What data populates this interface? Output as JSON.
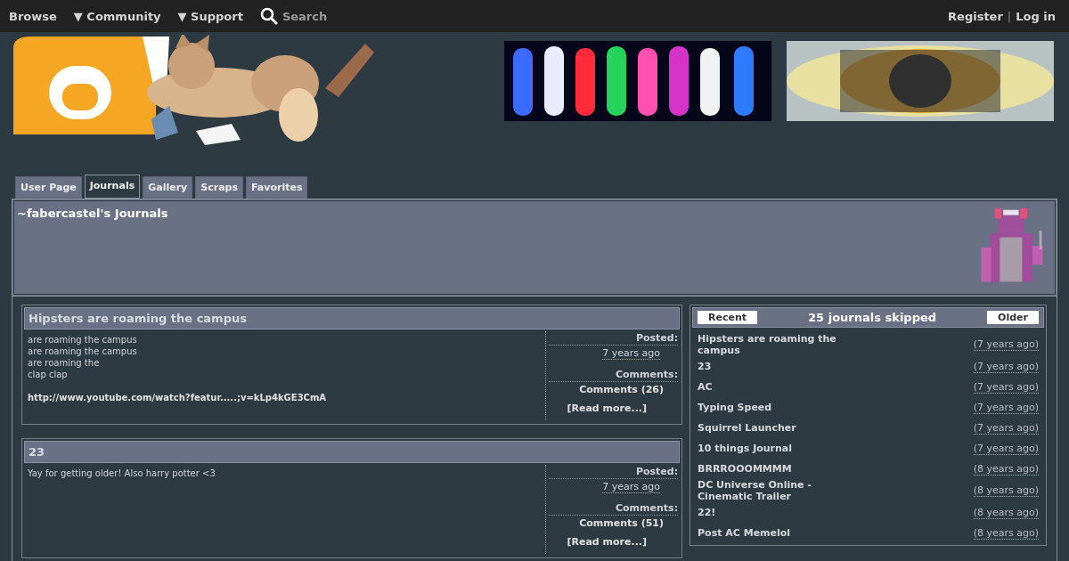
{
  "nav": {
    "items": [
      {
        "label": "Browse"
      },
      {
        "marker": "▼",
        "label": "Community"
      },
      {
        "marker": "▼",
        "label": "Support"
      }
    ],
    "search": "Search",
    "register": "Register",
    "separator": "|",
    "login": "Log in"
  },
  "tabs": [
    {
      "label": "User Page",
      "selected": false
    },
    {
      "label": "Journals",
      "selected": true
    },
    {
      "label": "Gallery",
      "selected": false
    },
    {
      "label": "Scraps",
      "selected": false
    },
    {
      "label": "Favorites",
      "selected": false
    }
  ],
  "profile": {
    "title": "~fabercastel's Journals"
  },
  "journals": [
    {
      "title": "Hipsters are roaming the campus",
      "lines": [
        "are roaming the campus",
        "are roaming the campus",
        "are roaming the",
        "clap clap"
      ],
      "link": "http://www.youtube.com/watch?featur.....;v=kLp4kGE3CmA",
      "posted_label": "Posted:",
      "posted": "7 years ago",
      "comments_label": "Comments:",
      "comments": "Comments (26)",
      "read_more": "[Read more...]"
    },
    {
      "title": "23",
      "lines": [
        "Yay for getting older! Also harry potter <3"
      ],
      "posted_label": "Posted:",
      "posted": "7 years ago",
      "comments_label": "Comments:",
      "comments": "Comments (51)",
      "read_more": "[Read more...]"
    }
  ],
  "sidebar": {
    "recent": "Recent",
    "heading": "25 journals skipped",
    "older": "Older",
    "items": [
      {
        "title": "Hipsters are roaming the campus",
        "age": "(7 years ago)"
      },
      {
        "title": "23",
        "age": "(7 years ago)"
      },
      {
        "title": "AC",
        "age": "(7 years ago)"
      },
      {
        "title": "Typing Speed",
        "age": "(7 years ago)"
      },
      {
        "title": "Squirrel Launcher",
        "age": "(7 years ago)"
      },
      {
        "title": "10 things Journal",
        "age": "(7 years ago)"
      },
      {
        "title": "BRRROOOMMMM",
        "age": "(8 years ago)"
      },
      {
        "title": "DC Universe Online - Cinematic Trailer",
        "age": "(8 years ago)"
      },
      {
        "title": "22!",
        "age": "(8 years ago)"
      },
      {
        "title": "Post AC Memelol",
        "age": "(8 years ago)"
      }
    ]
  }
}
